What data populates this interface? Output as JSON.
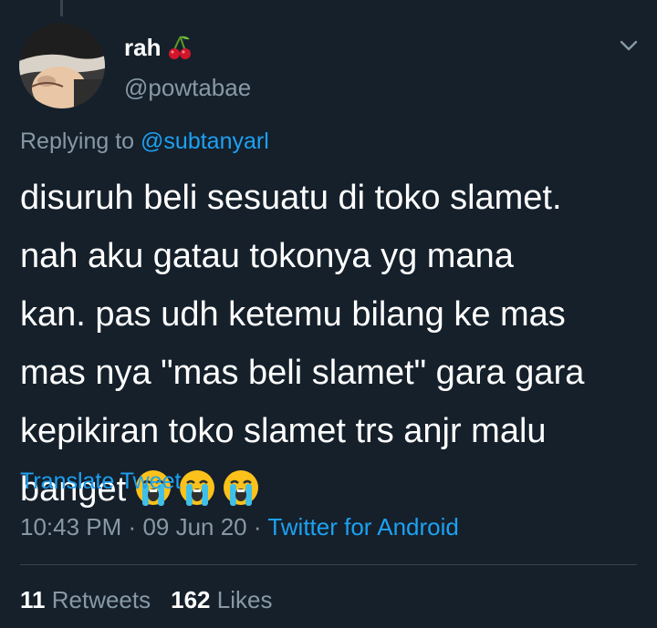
{
  "user": {
    "display_name": "rah",
    "name_emoji_icon": "cherries-icon",
    "handle": "@powtabae"
  },
  "reply": {
    "prefix": "Replying to",
    "mention": "@subtanyarl"
  },
  "tweet": {
    "lines": [
      "disuruh beli sesuatu di toko slamet.",
      "nah aku gatau tokonya yg mana",
      "kan. pas udh ketemu bilang ke mas",
      "mas nya \"mas beli slamet\" gara gara",
      "kepikiran toko slamet trs anjr malu",
      "banget"
    ],
    "trailing_emoji_icon": "loudly-crying-face-icon",
    "trailing_emoji_count": 3
  },
  "translate_label": "Translate Tweet",
  "meta": {
    "time": "10:43 PM",
    "separator": "·",
    "date": "09 Jun 20",
    "source": "Twitter for Android"
  },
  "stats": {
    "retweets_count": "11",
    "retweets_label": "Retweets",
    "likes_count": "162",
    "likes_label": "Likes"
  },
  "colors": {
    "background": "#15202b",
    "accent": "#1da1f2",
    "secondary_text": "#8899a6",
    "divider": "#38444d"
  }
}
